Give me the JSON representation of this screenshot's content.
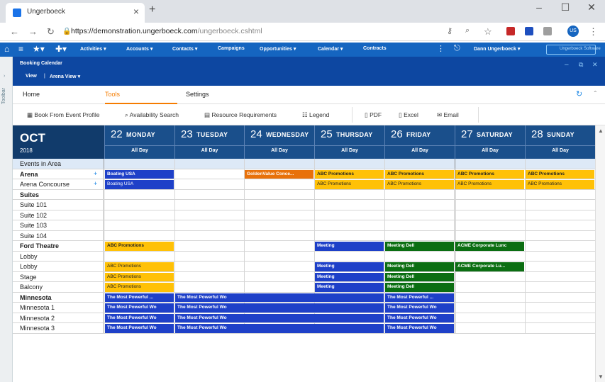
{
  "browser": {
    "tab_title": "Ungerboeck",
    "url_host": "https://demonstration.ungerboeck.com",
    "url_path": "/ungerboeck.cshtml",
    "profile_initials": "US"
  },
  "appnav": {
    "items": [
      "Activities",
      "Accounts",
      "Contacts",
      "Campaigns",
      "Opportunities",
      "Calendar",
      "Contracts"
    ],
    "user": "Dann Ungerboeck",
    "brand": "Ungerboeck Software"
  },
  "sub": {
    "title": "Booking Calendar",
    "view": "View",
    "arena_view": "Arena View"
  },
  "sidebar_label": "Toolbar",
  "tabs": [
    "Home",
    "Tools",
    "Settings"
  ],
  "toolbar": {
    "book": "Book From Event Profile",
    "availability": "Availability Search",
    "resources": "Resource Requirements",
    "legend": "Legend",
    "pdf": "PDF",
    "excel": "Excel",
    "email": "Email"
  },
  "calendar": {
    "month": "OCT",
    "year": "2018",
    "days": [
      {
        "num": "22",
        "name": "MONDAY",
        "allday": "All Day"
      },
      {
        "num": "23",
        "name": "TUESDAY",
        "allday": "All Day"
      },
      {
        "num": "24",
        "name": "WEDNESDAY",
        "allday": "All Day"
      },
      {
        "num": "25",
        "name": "THURSDAY",
        "allday": "All Day"
      },
      {
        "num": "26",
        "name": "FRIDAY",
        "allday": "All Day"
      },
      {
        "num": "27",
        "name": "SATURDAY",
        "allday": "All Day"
      },
      {
        "num": "28",
        "name": "SUNDAY",
        "allday": "All Day"
      }
    ],
    "rows": [
      {
        "label": "Events in Area",
        "bold": false,
        "shade": true,
        "events": []
      },
      {
        "label": "Arena",
        "bold": true,
        "plus": true,
        "events": [
          {
            "start": 0,
            "span": 1,
            "color": "blue",
            "text": "Boating USA"
          },
          {
            "start": 2,
            "span": 1,
            "color": "orange",
            "text": "GoldenValue Conce..."
          },
          {
            "start": 3,
            "span": 1,
            "color": "yellow",
            "text": "ABC Promotions"
          },
          {
            "start": 4,
            "span": 1,
            "color": "yellow",
            "text": "ABC Promotions"
          },
          {
            "start": 5,
            "span": 1,
            "color": "yellow",
            "text": "ABC Promotions"
          },
          {
            "start": 6,
            "span": 1,
            "color": "yellow",
            "text": "ABC Promotions"
          }
        ]
      },
      {
        "label": "Arena Concourse",
        "bold": false,
        "plus": true,
        "events": [
          {
            "start": 0,
            "span": 1,
            "color": "blue",
            "light": true,
            "text": "Boating USA"
          },
          {
            "start": 3,
            "span": 1,
            "color": "yellow",
            "light": true,
            "text": "ABC Promotions"
          },
          {
            "start": 4,
            "span": 1,
            "color": "yellow",
            "light": true,
            "text": "ABC Promotions"
          },
          {
            "start": 5,
            "span": 1,
            "color": "yellow",
            "light": true,
            "text": "ABC Promotions"
          },
          {
            "start": 6,
            "span": 1,
            "color": "yellow",
            "light": true,
            "text": "ABC Promotions"
          }
        ]
      },
      {
        "label": "Suites",
        "bold": true,
        "events": []
      },
      {
        "label": "Suite 101",
        "bold": false,
        "events": []
      },
      {
        "label": "Suite 102",
        "bold": false,
        "events": []
      },
      {
        "label": "Suite 103",
        "bold": false,
        "events": []
      },
      {
        "label": "Suite 104",
        "bold": false,
        "events": []
      },
      {
        "label": "Ford Theatre",
        "bold": true,
        "events": [
          {
            "start": 0,
            "span": 1,
            "color": "yellow",
            "text": "ABC Promotions"
          },
          {
            "start": 3,
            "span": 1,
            "color": "blue",
            "text": "Meeting"
          },
          {
            "start": 4,
            "span": 1,
            "color": "green",
            "text": "Meeting Dell"
          },
          {
            "start": 5,
            "span": 1,
            "color": "green",
            "text": "ACME Corporate Lunc"
          }
        ]
      },
      {
        "label": "Lobby",
        "bold": false,
        "events": []
      },
      {
        "label": "Lobby",
        "bold": false,
        "events": [
          {
            "start": 0,
            "span": 1,
            "color": "yellow",
            "light": true,
            "text": "ABC Promotions"
          },
          {
            "start": 3,
            "span": 1,
            "color": "blue",
            "text": "Meeting"
          },
          {
            "start": 4,
            "span": 1,
            "color": "green",
            "text": "Meeting Dell"
          },
          {
            "start": 5,
            "span": 1,
            "color": "green",
            "text": "ACME Corporate Lu..."
          }
        ]
      },
      {
        "label": "Stage",
        "bold": false,
        "events": [
          {
            "start": 0,
            "span": 1,
            "color": "yellow",
            "light": true,
            "text": "ABC Promotions"
          },
          {
            "start": 3,
            "span": 1,
            "color": "blue",
            "text": "Meeting"
          },
          {
            "start": 4,
            "span": 1,
            "color": "green",
            "text": "Meeting Dell"
          }
        ]
      },
      {
        "label": "Balcony",
        "bold": false,
        "events": [
          {
            "start": 0,
            "span": 1,
            "color": "yellow",
            "light": true,
            "text": "ABC Promotions"
          },
          {
            "start": 3,
            "span": 1,
            "color": "blue",
            "text": "Meeting"
          },
          {
            "start": 4,
            "span": 1,
            "color": "green",
            "text": "Meeting Dell"
          }
        ]
      },
      {
        "label": "Minnesota",
        "bold": true,
        "events": [
          {
            "start": 0,
            "span": 1,
            "color": "blue",
            "text": "The Most Powerful ..."
          },
          {
            "start": 1,
            "span": 3,
            "color": "blue",
            "text": "The Most Powerful Wo"
          },
          {
            "start": 4,
            "span": 1,
            "color": "blue",
            "text": "The Most Powerful ..."
          }
        ]
      },
      {
        "label": "Minnesota 1",
        "bold": false,
        "events": [
          {
            "start": 0,
            "span": 1,
            "color": "blue",
            "text": "The Most Powerful Wo"
          },
          {
            "start": 1,
            "span": 3,
            "color": "blue",
            "text": "The Most Powerful Wo"
          },
          {
            "start": 4,
            "span": 1,
            "color": "blue",
            "text": "The Most Powerful Wo"
          }
        ]
      },
      {
        "label": "Minnesota 2",
        "bold": false,
        "events": [
          {
            "start": 0,
            "span": 1,
            "color": "blue",
            "text": "The Most Powerful Wo"
          },
          {
            "start": 1,
            "span": 3,
            "color": "blue",
            "text": "The Most Powerful Wo"
          },
          {
            "start": 4,
            "span": 1,
            "color": "blue",
            "text": "The Most Powerful Wo"
          }
        ]
      },
      {
        "label": "Minnesota 3",
        "bold": false,
        "events": [
          {
            "start": 0,
            "span": 1,
            "color": "blue",
            "text": "The Most Powerful Wo"
          },
          {
            "start": 1,
            "span": 3,
            "color": "blue",
            "text": "The Most Powerful Wo"
          },
          {
            "start": 4,
            "span": 1,
            "color": "blue",
            "text": "The Most Powerful Wo"
          }
        ]
      }
    ]
  }
}
